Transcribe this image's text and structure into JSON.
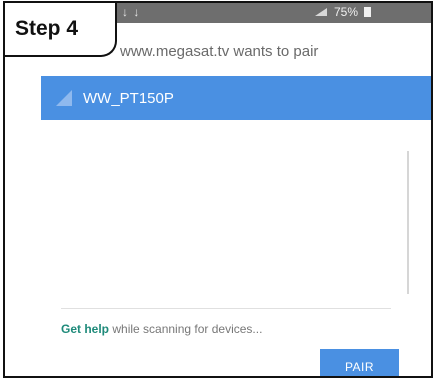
{
  "step": {
    "label": "Step 4"
  },
  "status_bar": {
    "left_icons": "↓ ↓",
    "battery": "75%"
  },
  "dialog": {
    "title": "www.megasat.tv wants to pair",
    "selected_device": "WW_PT150P",
    "help_link": "Get help",
    "help_text": " while scanning for devices...",
    "pair_button": "PAIR"
  },
  "colors": {
    "accent": "#4a90e2",
    "help_link": "#1e8a7a",
    "status_bar": "#6e6e6e"
  }
}
